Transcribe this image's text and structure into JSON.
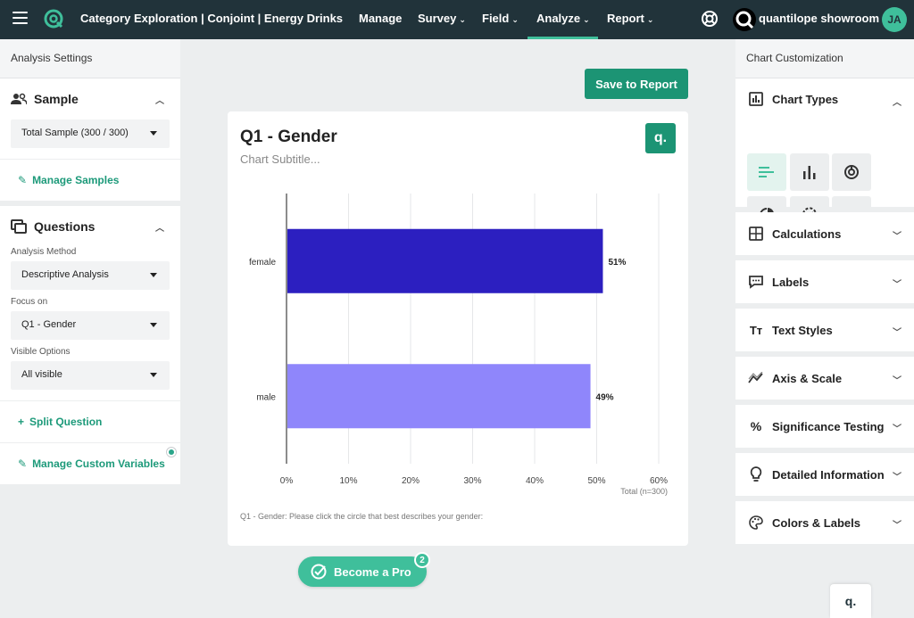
{
  "topbar": {
    "title": "Category Exploration | Conjoint | Energy Drinks",
    "nav": [
      {
        "label": "Manage",
        "dropdown": false
      },
      {
        "label": "Survey",
        "dropdown": true
      },
      {
        "label": "Field",
        "dropdown": true
      },
      {
        "label": "Analyze",
        "dropdown": true,
        "active": true
      },
      {
        "label": "Report",
        "dropdown": true
      }
    ],
    "brand": "quantilope showroom",
    "avatar": "JA"
  },
  "left": {
    "header": "Analysis Settings",
    "sample": {
      "title": "Sample",
      "value": "Total Sample (300 / 300)",
      "manage_link": "Manage Samples"
    },
    "questions": {
      "title": "Questions",
      "method_label": "Analysis Method",
      "method_value": "Descriptive Analysis",
      "focus_label": "Focus on",
      "focus_value": "Q1 - Gender",
      "visible_label": "Visible Options",
      "visible_value": "All visible",
      "split_link": "Split Question",
      "custom_link": "Manage Custom Variables"
    }
  },
  "center": {
    "save_button": "Save to Report",
    "title": "Q1 - Gender",
    "subtitle": "Chart Subtitle...",
    "logo": "q.",
    "footnote": "Q1 - Gender: Please click the circle that best describes your gender:",
    "total_label": "Total (n=300)",
    "pro_button": "Become a Pro",
    "pro_badge": "2"
  },
  "chart_data": {
    "type": "bar",
    "orientation": "horizontal",
    "categories": [
      "female",
      "male"
    ],
    "values": [
      51,
      49
    ],
    "value_labels": [
      "51%",
      "49%"
    ],
    "colors": [
      "#2c1fc0",
      "#8f86fb"
    ],
    "xlim": [
      0,
      60
    ],
    "xticks": [
      "0%",
      "10%",
      "20%",
      "30%",
      "40%",
      "50%",
      "60%"
    ],
    "grid": true,
    "title": "Q1 - Gender",
    "subtitle": "Chart Subtitle..."
  },
  "right": {
    "header": "Chart Customization",
    "chart_types_title": "Chart Types",
    "sections": [
      {
        "label": "Calculations",
        "icon": "calculator-icon"
      },
      {
        "label": "Labels",
        "icon": "speech-bubble-icon"
      },
      {
        "label": "Text Styles",
        "icon": "text-styles-icon"
      },
      {
        "label": "Axis & Scale",
        "icon": "axis-scale-icon"
      },
      {
        "label": "Significance Testing",
        "icon": "percent-icon"
      },
      {
        "label": "Detailed Information",
        "icon": "lightbulb-icon"
      },
      {
        "label": "Colors & Labels",
        "icon": "palette-icon"
      }
    ],
    "mini_logo": "q."
  },
  "colors": {
    "topbar": "#21333a",
    "accent": "#1c9474",
    "accent_light": "#3fbf9b"
  }
}
